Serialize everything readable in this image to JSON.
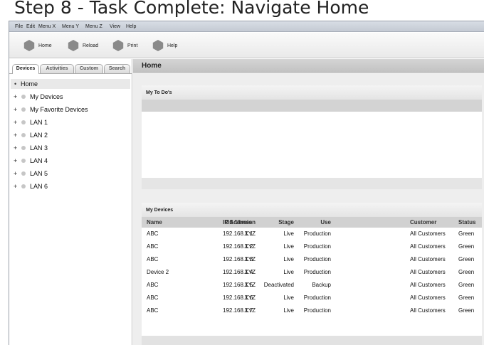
{
  "step_title": "Step 8 - Task Complete: Navigate Home",
  "menu": [
    "File",
    "Edit",
    "Menu X",
    "Menu Y",
    "Menu Z",
    "View",
    "Help"
  ],
  "toolbar": {
    "home_label": "Home",
    "reload_label": "Reload",
    "print_label": "Print",
    "help_label": "Help"
  },
  "tabs": [
    "Devices",
    "Activities",
    "Custom",
    "Search"
  ],
  "tree": {
    "home": "Home",
    "items": [
      "My Devices",
      "My Favorite Devices",
      "LAN 1",
      "LAN 2",
      "LAN 3",
      "LAN 4",
      "LAN 5",
      "LAN 6"
    ]
  },
  "main": {
    "title": "Home",
    "todo_title": "My To Do's",
    "devices_title": "My Devices"
  },
  "devices_table": {
    "columns": [
      "Name",
      "IP Address",
      "OS Version",
      "Stage",
      "Use",
      "Customer",
      "Status"
    ],
    "rows": [
      [
        "ABC",
        "192.168.1.1",
        "XYZ",
        "Live",
        "Production",
        "All Customers",
        "Green"
      ],
      [
        "ABC",
        "192.168.1.2",
        "XYZ",
        "Live",
        "Production",
        "All Customers",
        "Green"
      ],
      [
        "ABC",
        "192.168.1.3",
        "XYZ",
        "Live",
        "Production",
        "All Customers",
        "Green"
      ],
      [
        "Device 2",
        "192.168.1.4",
        "XYZ",
        "Live",
        "Production",
        "All Customers",
        "Green"
      ],
      [
        "ABC",
        "192.168.1.5",
        "XYZ",
        "Deactivated",
        "Backup",
        "All Customers",
        "Green"
      ],
      [
        "ABC",
        "192.168.1.6",
        "XYZ",
        "Live",
        "Production",
        "All Customers",
        "Green"
      ],
      [
        "ABC",
        "192.168.1.7",
        "XYZ",
        "Live",
        "Production",
        "All Customers",
        "Green"
      ]
    ]
  }
}
